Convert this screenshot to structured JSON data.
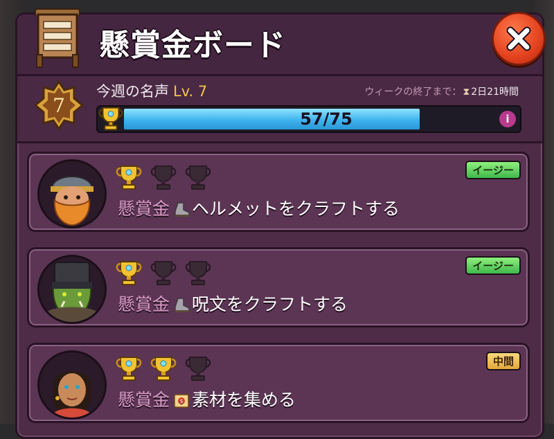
{
  "header": {
    "title": "懸賞金ボード",
    "board_icon": "bounty-board-icon",
    "close_icon": "close-x-icon"
  },
  "fame": {
    "level_number": "7",
    "label": "今週の名声",
    "level_text": "Lv. 7",
    "week_end_label": "ウィークの終了まで：",
    "week_end_time": "2日21時間",
    "progress_text": "57/75",
    "progress_fraction": 0.76,
    "info_label": "i"
  },
  "colors": {
    "panel": "#4e2b46",
    "progress_fill": "#3fb3ee",
    "gold": "#f4c44a",
    "easy": "#3fb84b",
    "medium": "#e3a93a",
    "close": "#e2411e"
  },
  "bounties": [
    {
      "portrait": "dwarf-portrait",
      "trophies_earned": 1,
      "trophies_total": 3,
      "difficulty": "イージー",
      "prefix": "懸賞金",
      "task_icon": "boot-icon",
      "task": "ヘルメットをクラフトする"
    },
    {
      "portrait": "orc-portrait",
      "trophies_earned": 1,
      "trophies_total": 3,
      "difficulty": "イージー",
      "prefix": "懸賞金",
      "task_icon": "boot-icon",
      "task": "呪文をクラフトする"
    },
    {
      "portrait": "elf-portrait",
      "trophies_earned": 2,
      "trophies_total": 3,
      "difficulty": "中間",
      "prefix": "懸賞金",
      "task_icon": "scroll-icon",
      "task": "素材を集める"
    }
  ]
}
